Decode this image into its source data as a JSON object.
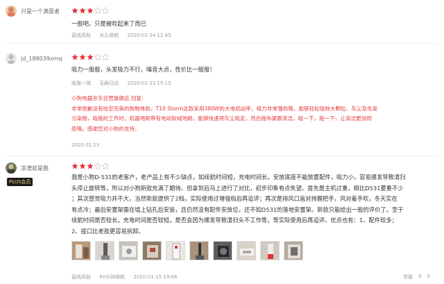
{
  "reviews": [
    {
      "user": "只是一个满意者",
      "stars": 3,
      "text": "一般吧。只是被吹起来了而已",
      "meta": [
        "直线风轨",
        "长久续航",
        "2020-01-24 12:45"
      ]
    },
    {
      "user": "jd_188039xmq",
      "stars": 3,
      "text": "吸力一般般，头发吸力不行。噪音大点，性价比一般般！",
      "meta": [
        "吸拖一体",
        "无刷马达",
        "2020-01-23 15:15"
      ],
      "reply_title": "小狗电器京东自营旗舰店 回复:",
      "reply_lines": [
        "非常抱歉没有给您完美的购物体验，T10 Storm这款采用380W的大电机动率，吸力非常强劲哦，能够轻松吸除大颗粒、灰尘及毛发",
        "污染物，吸拖的工作时，机器地刷带有电动软绒地刷，能够快速将灰尘吸走，然后拖布紧跟清洁，吸一下，拖一下，让清洁更加彻",
        "底哦。感谢您对小狗的支持。"
      ],
      "reply_date": "2020.01.23"
    },
    {
      "user": "凉澄就是我",
      "badge": "PLUS会员",
      "stars": 3,
      "lines": [
        "我是小狗D-531的老客户，老产品上有不少缺点，如续航时间短，充电时间长，安放底座不能放置配件，吸力小，容易缠发导致清扫",
        "头停止旋转等，所以对小狗新款充满了期待。但拿到后马上进行了对比，初步印象有点失望。首先是主机过重，相比D531要重不少",
        "；其次感觉吸力并不大，当然新款提供了2档，实际使用过增强档后再追评；再次是排风口直对持握把手，风对着手吹，冬天实在",
        "有点冷；最后安置架需在墙上钻孔后安装，且仍然没有配件安放位，还不如D531的落地安置架。新款只能给出一般的评价了。至于",
        "续航时间是否较长，充电时间是否较短，是否会因为缠发导致清扫头不工作等，等实际使用后再追评。优点也有：1、配件较多；",
        "2、接口比老款更容易拆卸。"
      ],
      "meta": [
        "直线风轨",
        "60分钟续航",
        "2020-01-15 19:06"
      ],
      "actions": [
        "举报",
        "0",
        "0"
      ],
      "thumbs": [
        "photo-1",
        "photo-2",
        "photo-3",
        "photo-4",
        "photo-5",
        "photo-6",
        "photo-7",
        "photo-8",
        "photo-9",
        "photo-10"
      ]
    }
  ],
  "colors": {
    "star": "#e4393c",
    "reply": "#e4393c",
    "meta": "#999999"
  }
}
